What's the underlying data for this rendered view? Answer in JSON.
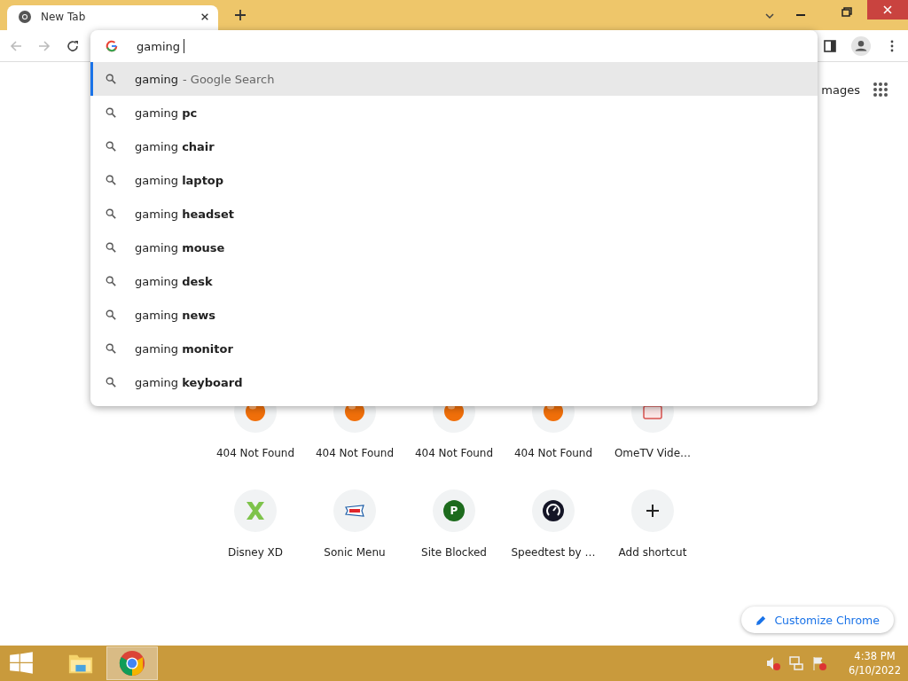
{
  "tab": {
    "title": "New Tab",
    "selected": true
  },
  "omnibox": {
    "value": "gaming"
  },
  "suggestions": [
    {
      "text": "gaming",
      "hint": "- Google Search",
      "selected": true
    },
    {
      "text": "gaming **pc**",
      "selected": false
    },
    {
      "text": "gaming **chair**",
      "selected": false
    },
    {
      "text": "gaming **laptop**",
      "selected": false
    },
    {
      "text": "gaming **headset**",
      "selected": false
    },
    {
      "text": "gaming **mouse**",
      "selected": false
    },
    {
      "text": "gaming **desk**",
      "selected": false
    },
    {
      "text": "gaming **news**",
      "selected": false
    },
    {
      "text": "gaming **monitor**",
      "selected": false
    },
    {
      "text": "gaming **keyboard**",
      "selected": false
    }
  ],
  "header_link": "mages",
  "shortcuts": [
    {
      "kind": "ball",
      "label": "404 Not Found"
    },
    {
      "kind": "ball",
      "label": "404 Not Found"
    },
    {
      "kind": "ball",
      "label": "404 Not Found"
    },
    {
      "kind": "ball",
      "label": "404 Not Found"
    },
    {
      "kind": "tv",
      "label": "OmeTV Vide…"
    },
    {
      "kind": "cross",
      "label": "Disney XD"
    },
    {
      "kind": "sign",
      "label": "Sonic Menu"
    },
    {
      "kind": "letter",
      "label": "Site Blocked",
      "letter": "P"
    },
    {
      "kind": "gauge",
      "label": "Speedtest by …"
    },
    {
      "kind": "add",
      "label": "Add shortcut"
    }
  ],
  "customize_button": "Customize Chrome",
  "taskbar": {
    "apps": [
      {
        "kind": "explorer",
        "selected": false
      },
      {
        "kind": "chrome",
        "selected": true
      }
    ],
    "time": "4:38 PM",
    "date": "6/10/2022"
  }
}
